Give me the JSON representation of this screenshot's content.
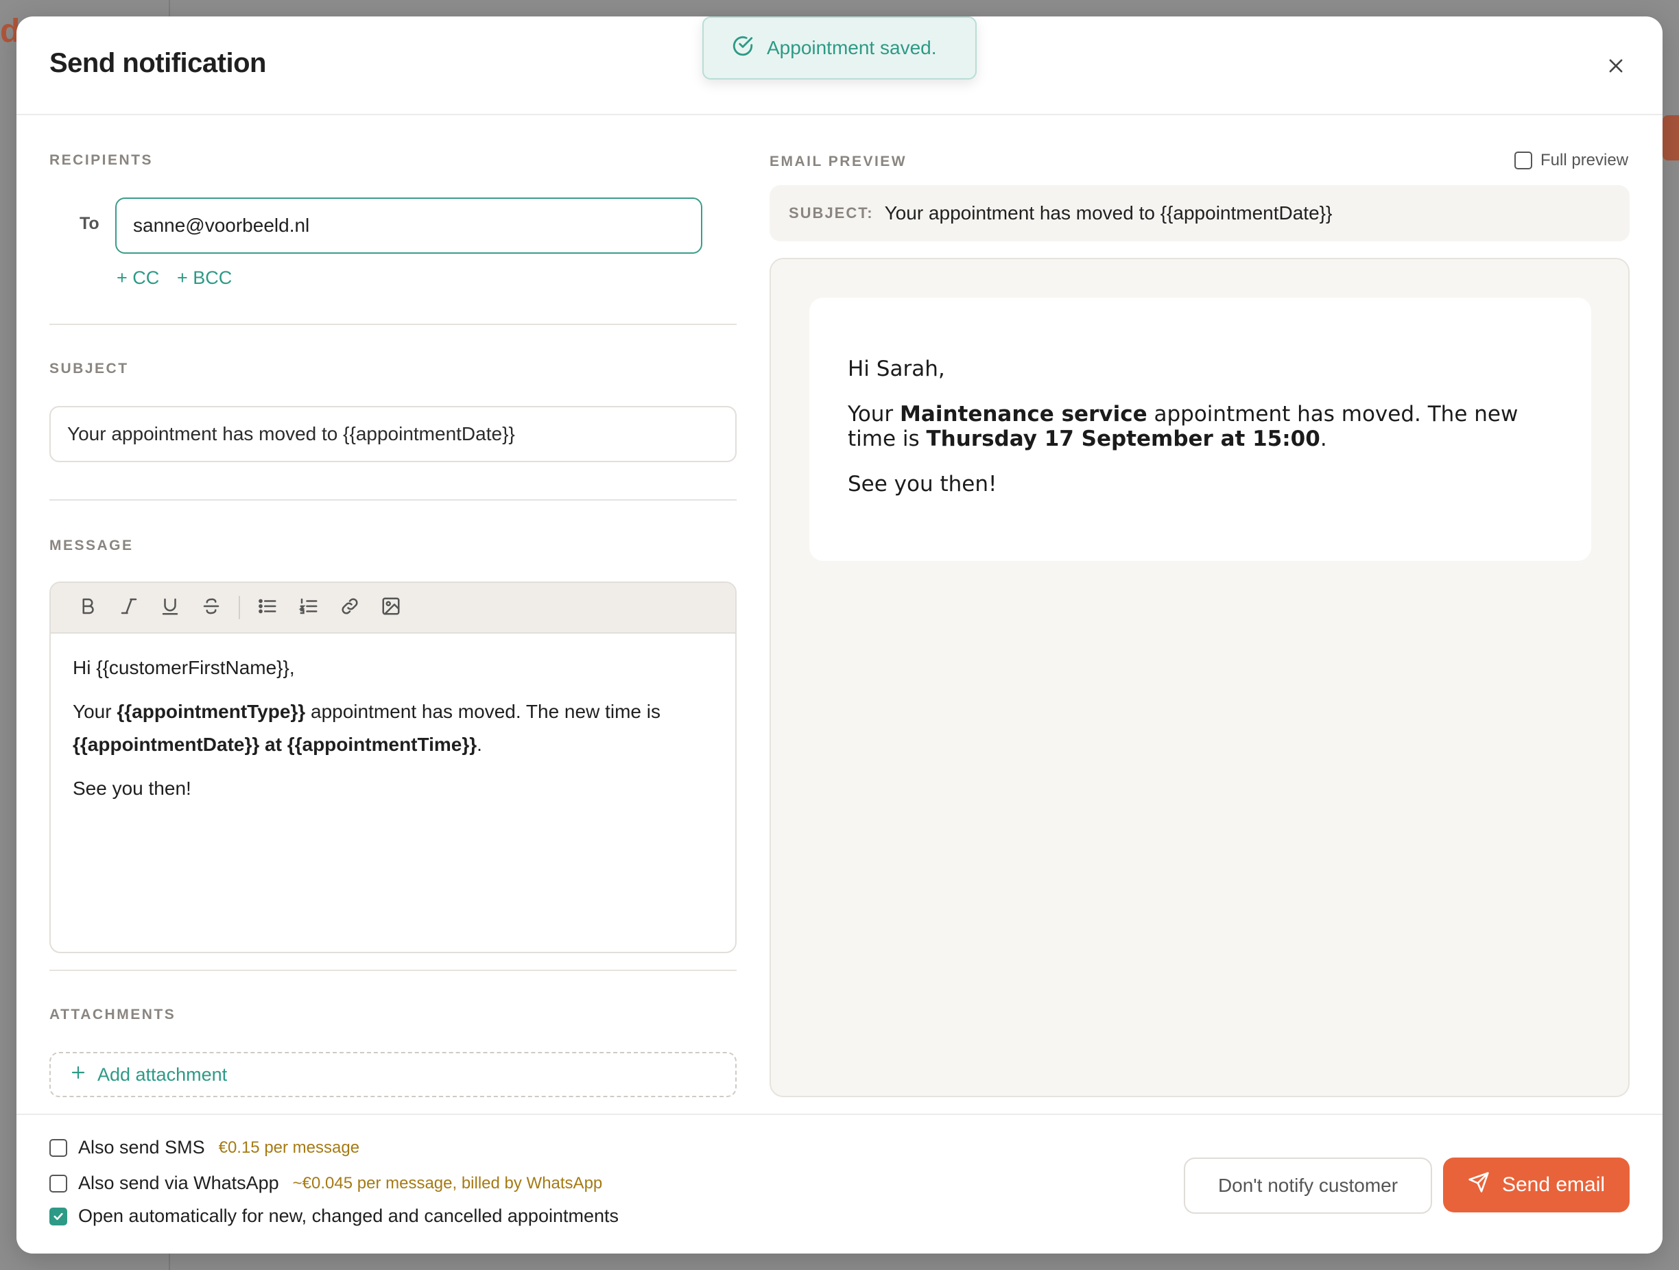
{
  "toast": {
    "message": "Appointment saved.",
    "icon": "check-circle-icon"
  },
  "modal": {
    "title": "Send notification",
    "close_icon": "close-icon"
  },
  "recipients": {
    "label": "RECIPIENTS",
    "to_label": "To",
    "to_value": "sanne@voorbeeld.nl",
    "cc_label": "+ CC",
    "bcc_label": "+ BCC"
  },
  "subject": {
    "label": "SUBJECT",
    "value": "Your appointment has moved to {{appointmentDate}}"
  },
  "message": {
    "label": "MESSAGE",
    "toolbar": [
      "bold-icon",
      "italic-icon",
      "underline-icon",
      "strikethrough-icon",
      "bullet-list-icon",
      "numbered-list-icon",
      "link-icon",
      "image-icon"
    ],
    "body": {
      "greeting": "Hi {{customerFirstName}},",
      "line_prefix": "Your ",
      "appointment_type": "{{appointmentType}}",
      "line_middle": " appointment has moved. The new time is ",
      "appointment_when": "{{appointmentDate}} at {{appointmentTime}}",
      "line_end": ".",
      "closing": "See you then!"
    }
  },
  "attachments": {
    "label": "ATTACHMENTS",
    "add_label": "Add attachment"
  },
  "preview": {
    "label": "EMAIL PREVIEW",
    "full_preview_label": "Full preview",
    "full_preview_checked": false,
    "subject_label": "SUBJECT:",
    "subject_value": "Your appointment has moved to {{appointmentDate}}",
    "greeting": "Hi Sarah,",
    "line_prefix": "Your ",
    "appointment_type": "Maintenance service",
    "line_middle": " appointment has moved. The new time is ",
    "appointment_when": "Thursday 17 September at 15:00",
    "line_end": ".",
    "closing": "See you then!"
  },
  "footer": {
    "sms": {
      "label": "Also send SMS",
      "price": "€0.15 per message",
      "checked": false
    },
    "whatsapp": {
      "label": "Also send via WhatsApp",
      "price": "~€0.045 per message, billed by WhatsApp",
      "checked": false
    },
    "auto_open": {
      "label": "Open automatically for new, changed and cancelled appointments",
      "checked": true
    },
    "dont_notify_label": "Don't notify customer",
    "send_label": "Send email"
  },
  "colors": {
    "accent_teal": "#2c9a86",
    "primary_orange": "#e8633a",
    "price_gold": "#a57a14"
  }
}
